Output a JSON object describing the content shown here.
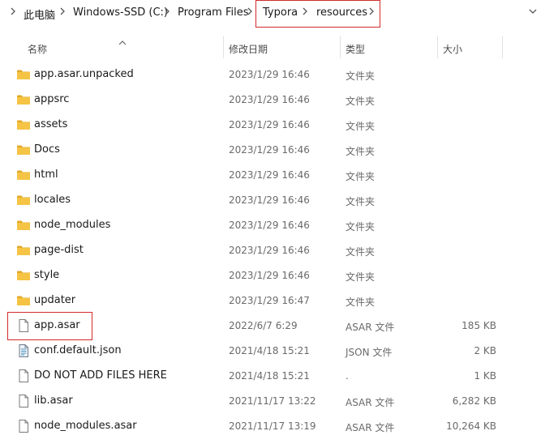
{
  "breadcrumb": {
    "items": [
      "此电脑",
      "Windows-SSD (C:)",
      "Program Files",
      "Typora",
      "resources"
    ]
  },
  "columns": {
    "name": "名称",
    "date": "修改日期",
    "type": "类型",
    "size": "大小"
  },
  "files": [
    {
      "name": "app.asar.unpacked",
      "date": "2023/1/29 16:46",
      "type": "文件夹",
      "size": "",
      "icon": "folder-icon"
    },
    {
      "name": "appsrc",
      "date": "2023/1/29 16:46",
      "type": "文件夹",
      "size": "",
      "icon": "folder-icon"
    },
    {
      "name": "assets",
      "date": "2023/1/29 16:46",
      "type": "文件夹",
      "size": "",
      "icon": "folder-icon"
    },
    {
      "name": "Docs",
      "date": "2023/1/29 16:46",
      "type": "文件夹",
      "size": "",
      "icon": "folder-icon"
    },
    {
      "name": "html",
      "date": "2023/1/29 16:46",
      "type": "文件夹",
      "size": "",
      "icon": "folder-icon"
    },
    {
      "name": "locales",
      "date": "2023/1/29 16:46",
      "type": "文件夹",
      "size": "",
      "icon": "folder-icon"
    },
    {
      "name": "node_modules",
      "date": "2023/1/29 16:46",
      "type": "文件夹",
      "size": "",
      "icon": "folder-icon"
    },
    {
      "name": "page-dist",
      "date": "2023/1/29 16:46",
      "type": "文件夹",
      "size": "",
      "icon": "folder-icon"
    },
    {
      "name": "style",
      "date": "2023/1/29 16:46",
      "type": "文件夹",
      "size": "",
      "icon": "folder-icon"
    },
    {
      "name": "updater",
      "date": "2023/1/29 16:47",
      "type": "文件夹",
      "size": "",
      "icon": "folder-icon"
    },
    {
      "name": "app.asar",
      "date": "2022/6/7 6:29",
      "type": "ASAR 文件",
      "size": "185 KB",
      "icon": "file-icon"
    },
    {
      "name": "conf.default.json",
      "date": "2021/4/18 15:21",
      "type": "JSON 文件",
      "size": "2 KB",
      "icon": "json-file-icon"
    },
    {
      "name": "DO NOT ADD FILES HERE",
      "date": "2021/4/18 15:21",
      "type": ".",
      "size": "1 KB",
      "icon": "file-icon"
    },
    {
      "name": "lib.asar",
      "date": "2021/11/17 13:22",
      "type": "ASAR 文件",
      "size": "6,282 KB",
      "icon": "file-icon"
    },
    {
      "name": "node_modules.asar",
      "date": "2021/11/17 13:19",
      "type": "ASAR 文件",
      "size": "10,264 KB",
      "icon": "file-icon"
    }
  ],
  "colors": {
    "highlight_border": "#d12a2a",
    "folder_fill": "#f5c445",
    "folder_tab": "#e3a92a"
  }
}
